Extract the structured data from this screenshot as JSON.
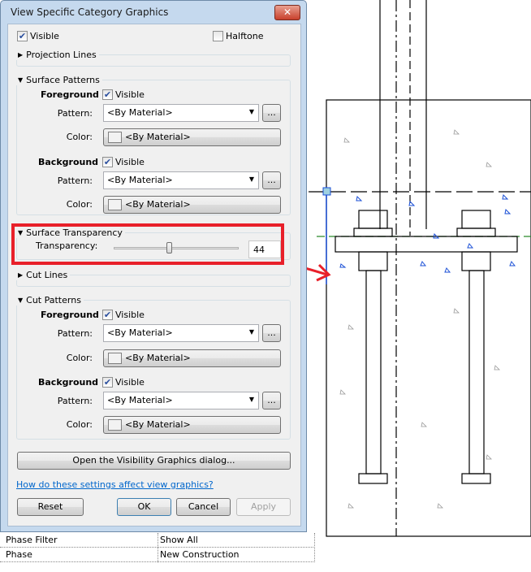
{
  "dialog": {
    "title": "View Specific Category Graphics",
    "close_label": "✕",
    "visible_label": "Visible",
    "visible_checked": true,
    "halftone_label": "Halftone",
    "halftone_checked": false,
    "projection_lines": "Projection Lines",
    "surface_patterns": {
      "title": "Surface Patterns",
      "foreground": {
        "label": "Foreground",
        "visible_label": "Visible",
        "visible": true,
        "pattern_label": "Pattern:",
        "pattern": "<By Material>",
        "color_label": "Color:",
        "color": "<By Material>"
      },
      "background": {
        "label": "Background",
        "visible_label": "Visible",
        "visible": true,
        "pattern_label": "Pattern:",
        "pattern": "<By Material>",
        "color_label": "Color:",
        "color": "<By Material>"
      }
    },
    "surface_transparency": {
      "title": "Surface Transparency",
      "label": "Transparency:",
      "value": "44",
      "percent": 44
    },
    "cut_lines": "Cut Lines",
    "cut_patterns": {
      "title": "Cut Patterns",
      "foreground": {
        "label": "Foreground",
        "visible_label": "Visible",
        "visible": true,
        "pattern_label": "Pattern:",
        "pattern": "<By Material>",
        "color_label": "Color:",
        "color": "<By Material>"
      },
      "background": {
        "label": "Background",
        "visible_label": "Visible",
        "visible": true,
        "pattern_label": "Pattern:",
        "pattern": "<By Material>",
        "color_label": "Color:",
        "color": "<By Material>"
      }
    },
    "browse_label": "...",
    "open_vg_button": "Open the Visibility Graphics dialog...",
    "help_link": "How do these settings affect view graphics?",
    "buttons": {
      "reset": "Reset",
      "ok": "OK",
      "cancel": "Cancel",
      "apply": "Apply"
    }
  },
  "properties": [
    {
      "name": "Phase Filter",
      "value": "Show All"
    },
    {
      "name": "Phase",
      "value": "New Construction"
    }
  ],
  "colors": {
    "highlight": "#e8202a",
    "link": "#0066cc",
    "selection": "#1a4fd6"
  }
}
